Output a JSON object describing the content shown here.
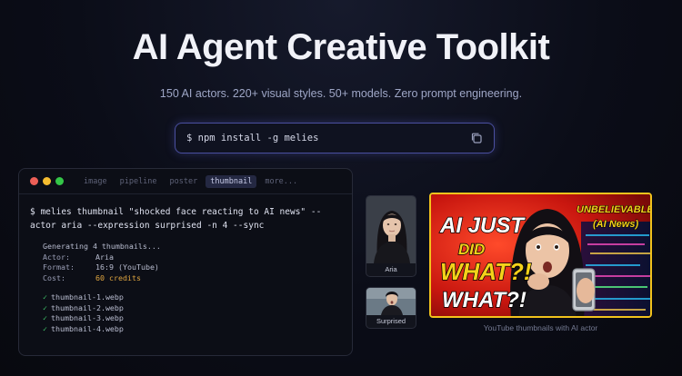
{
  "hero": {
    "title": "AI Agent Creative Toolkit",
    "subtitle": "150 AI actors. 220+ visual styles. 50+ models. Zero prompt engineering.",
    "install_command": "$ npm install -g melies"
  },
  "terminal": {
    "tabs": [
      {
        "label": "image",
        "active": false
      },
      {
        "label": "pipeline",
        "active": false
      },
      {
        "label": "poster",
        "active": false
      },
      {
        "label": "thumbnail",
        "active": true
      },
      {
        "label": "more...",
        "active": false
      }
    ],
    "command_line1": "$ melies thumbnail \"shocked face reacting to AI news\" --",
    "command_line2": "actor aria --expression surprised -n 4 --sync",
    "output_header": "Generating 4 thumbnails...",
    "actor_key": "Actor:",
    "actor_value": "Aria",
    "format_key": "Format:",
    "format_value": "16:9 (YouTube)",
    "cost_key": "Cost:",
    "cost_value": "60 credits",
    "check": "✓",
    "files": [
      "thumbnail-1.webp",
      "thumbnail-2.webp",
      "thumbnail-3.webp",
      "thumbnail-4.webp"
    ]
  },
  "actors": {
    "aria_label": "Aria",
    "surprised_label": "Surprised"
  },
  "thumbnail": {
    "headline_l1": "AI JUST",
    "headline_l2": "DID",
    "headline_l3": "WHAT?!",
    "headline_l4": "WHAT?!",
    "badge_l1": "UNBELIEVABLE!",
    "badge_l2": "(AI News)",
    "caption": "YouTube thumbnails with AI actor"
  },
  "colors": {
    "dot_red": "#ed5f57",
    "dot_yellow": "#f5bd30",
    "dot_green": "#34c648",
    "accent_yellow": "#f5d21a",
    "thumb_red": "#d41f1a"
  }
}
